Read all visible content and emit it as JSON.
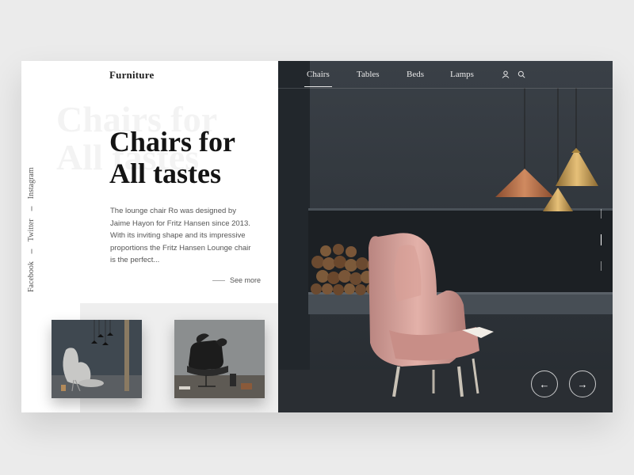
{
  "brand": "Furniture",
  "social": [
    {
      "label": "Facebook"
    },
    {
      "label": "Twitter"
    },
    {
      "label": "Instagram"
    }
  ],
  "hero": {
    "ghost_text": "Chairs for\nAll tastes",
    "headline": "Chairs for\nAll tastes",
    "description": "The lounge chair Ro was designed by Jaime Hayon for Fritz Hansen since 2013. With its inviting shape and its impressive proportions the Fritz Hansen Lounge chair is the perfect...",
    "see_more": "See more"
  },
  "nav": {
    "items": [
      {
        "label": "Chairs",
        "active": true
      },
      {
        "label": "Tables",
        "active": false
      },
      {
        "label": "Beds",
        "active": false
      },
      {
        "label": "Lamps",
        "active": false
      }
    ],
    "icons": [
      "user-icon",
      "search-icon"
    ]
  },
  "slider": {
    "prev_glyph": "←",
    "next_glyph": "→",
    "active_index": 1,
    "count": 3
  },
  "colors": {
    "accent_dark": "#141414",
    "scene_bg": "#2d3238",
    "chair_pink": "#d8a7a0",
    "lamp_copper": "#b5714a",
    "lamp_gold": "#c9a35a"
  }
}
